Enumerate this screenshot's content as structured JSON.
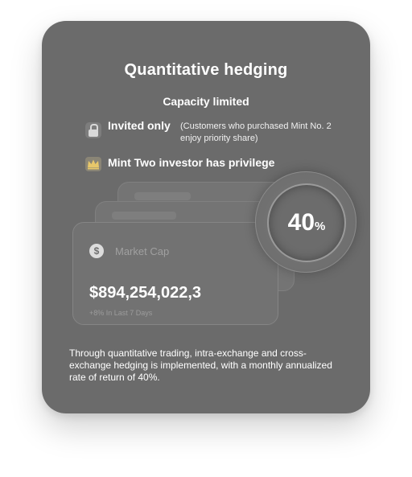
{
  "card": {
    "title": "Quantitative hedging",
    "subtitle": "Capacity limited",
    "invited": {
      "label": "Invited only",
      "note": "(Customers who purchased Mint No. 2 enjoy priority share)",
      "icon": "lock-icon"
    },
    "privilege": {
      "label": "Mint Two investor has privilege",
      "icon": "crown-icon",
      "icon_color": "#e7c76a"
    },
    "market_cap": {
      "icon": "dollar-icon",
      "label": "Market Cap",
      "value": "$894,254,022,3",
      "change": "+8% In Last 7 Days"
    },
    "dial": {
      "value": "40",
      "unit": "%"
    },
    "description": "Through quantitative trading, intra-exchange and cross-exchange hedging is implemented, with a monthly annualized rate of return of 40%.",
    "background_color": "#6b6b6b"
  }
}
